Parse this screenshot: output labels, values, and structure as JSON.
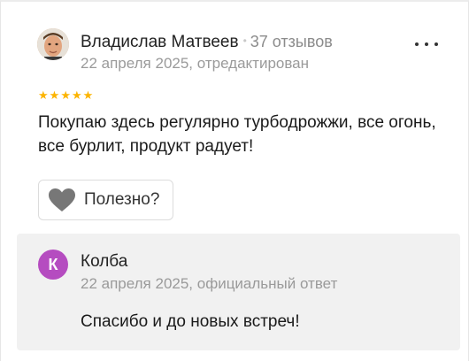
{
  "review": {
    "author_name": "Владислав Матвеев",
    "review_count": "37 отзывов",
    "date": "22 апреля 2025, отредактирован",
    "rating": 5,
    "text": "Покупаю здесь регулярно турбодрожжи, все огонь, все бурлит, продукт радует!",
    "helpful_label": "Полезно?",
    "star_color": "#fcb400"
  },
  "reply": {
    "avatar_letter": "К",
    "author_name": "Колба",
    "date": "22 апреля 2025, официальный ответ",
    "text": "Спасибо и до новых встреч!",
    "avatar_color": "#b54cc0"
  },
  "icons": {
    "more": "more-dots-icon",
    "heart": "heart-icon",
    "star": "star-icon"
  }
}
